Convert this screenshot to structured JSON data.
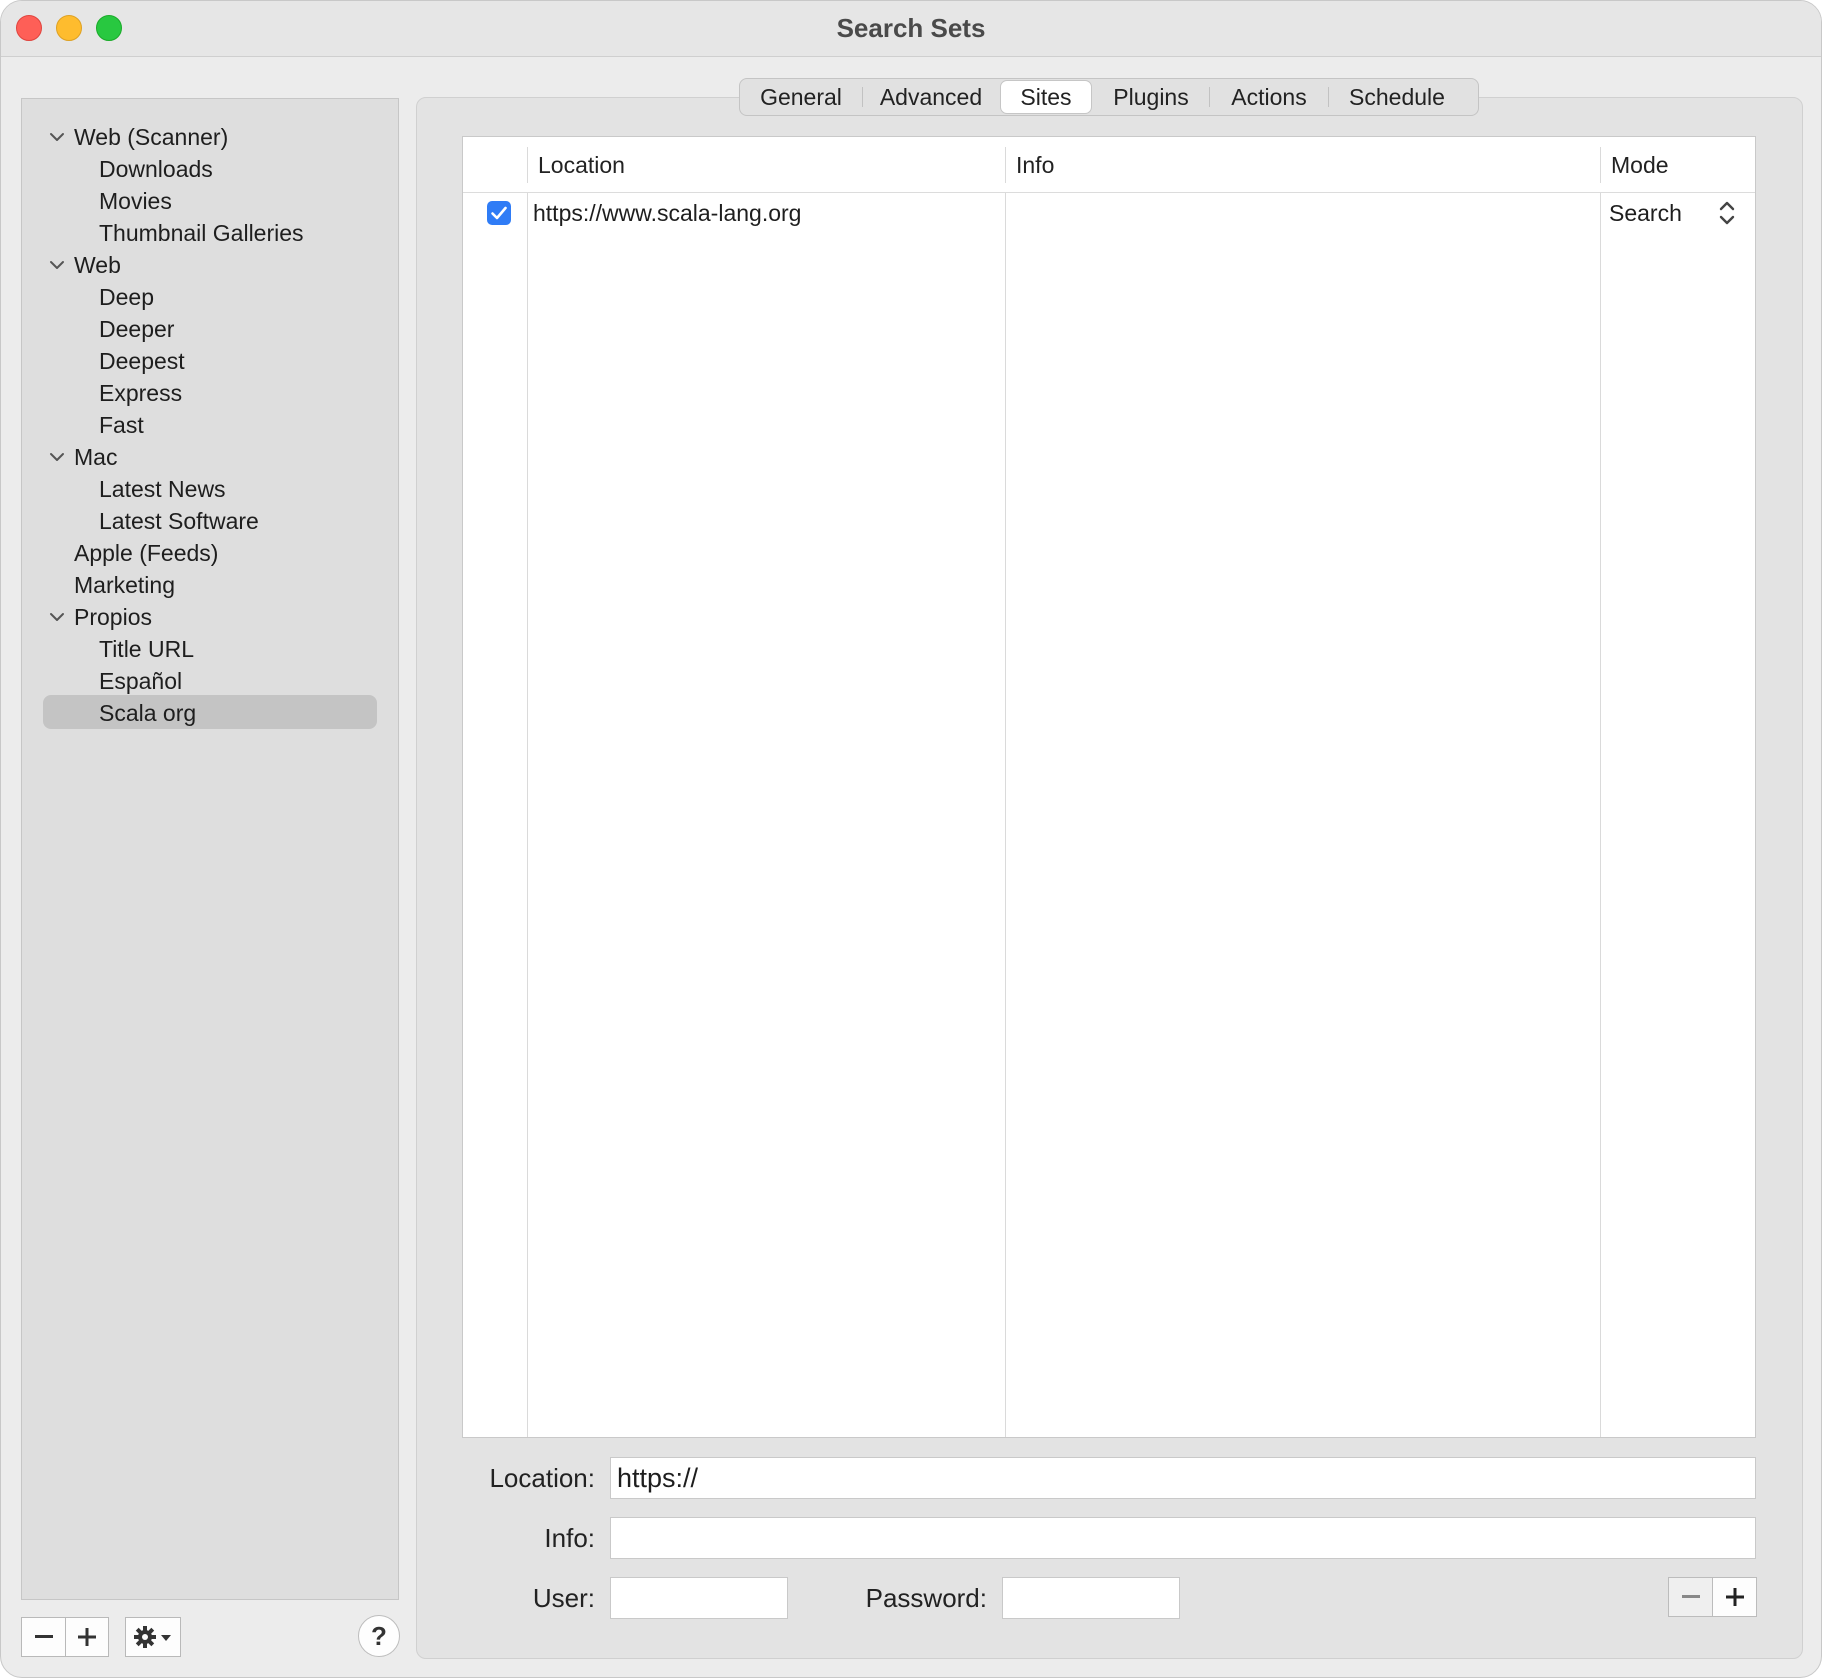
{
  "window": {
    "title": "Search Sets"
  },
  "sidebar": {
    "items": [
      {
        "label": "Web (Scanner)",
        "level": 0,
        "expanded": true
      },
      {
        "label": "Downloads",
        "level": 1
      },
      {
        "label": "Movies",
        "level": 1
      },
      {
        "label": "Thumbnail Galleries",
        "level": 1
      },
      {
        "label": "Web",
        "level": 0,
        "expanded": true
      },
      {
        "label": "Deep",
        "level": 1
      },
      {
        "label": "Deeper",
        "level": 1
      },
      {
        "label": "Deepest",
        "level": 1
      },
      {
        "label": "Express",
        "level": 1
      },
      {
        "label": "Fast",
        "level": 1
      },
      {
        "label": "Mac",
        "level": 0,
        "expanded": true
      },
      {
        "label": "Latest News",
        "level": 1
      },
      {
        "label": "Latest Software",
        "level": 1
      },
      {
        "label": "Apple (Feeds)",
        "level": 0
      },
      {
        "label": "Marketing",
        "level": 0
      },
      {
        "label": "Propios",
        "level": 0,
        "expanded": true
      },
      {
        "label": "Title URL",
        "level": 1
      },
      {
        "label": "Español",
        "level": 1
      },
      {
        "label": "Scala org",
        "level": 1,
        "selected": true
      }
    ],
    "help_label": "?"
  },
  "tabs": [
    {
      "label": "General"
    },
    {
      "label": "Advanced"
    },
    {
      "label": "Sites",
      "active": true
    },
    {
      "label": "Plugins"
    },
    {
      "label": "Actions"
    },
    {
      "label": "Schedule"
    }
  ],
  "table": {
    "columns": {
      "location": "Location",
      "info": "Info",
      "mode": "Mode"
    },
    "rows": [
      {
        "enabled": true,
        "location": "https://www.scala-lang.org",
        "info": "",
        "mode": "Search"
      }
    ]
  },
  "form": {
    "location_label": "Location:",
    "location_value": "https://",
    "info_label": "Info:",
    "info_value": "",
    "user_label": "User:",
    "user_value": "",
    "password_label": "Password:",
    "password_value": ""
  },
  "colors": {
    "accent": "#2f7cf6",
    "selection": "#c4c4c4"
  }
}
